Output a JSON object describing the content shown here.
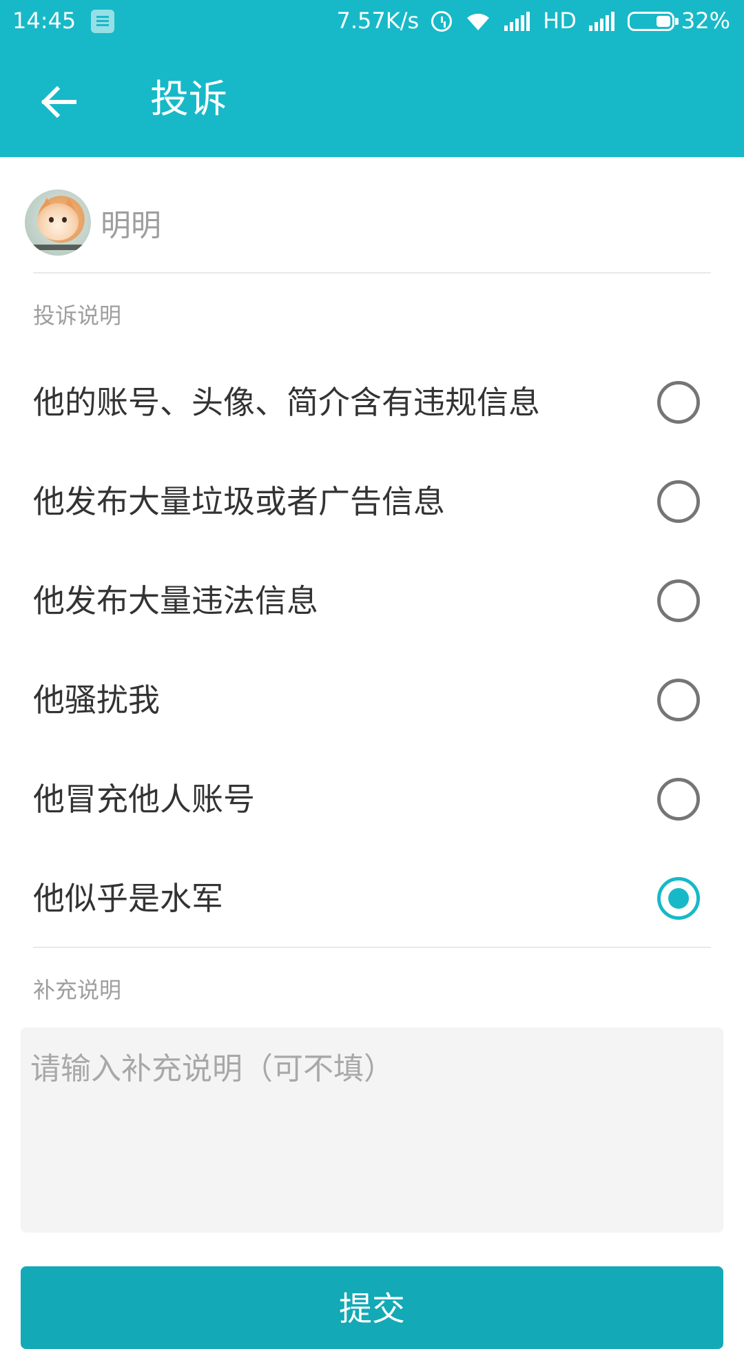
{
  "status_bar": {
    "time": "14:45",
    "net_speed": "7.57K/s",
    "network_type": "HD",
    "battery": "32%",
    "icons": [
      "notification-icon",
      "alarm-icon",
      "wifi-icon",
      "signal-icon",
      "signal-icon",
      "battery-icon"
    ]
  },
  "header": {
    "title": "投诉",
    "back_icon": "arrow-left-icon"
  },
  "user": {
    "name": "明明"
  },
  "complaint": {
    "section_label": "投诉说明",
    "options": [
      {
        "label": "他的账号、头像、简介含有违规信息",
        "checked": false
      },
      {
        "label": "他发布大量垃圾或者广告信息",
        "checked": false
      },
      {
        "label": "他发布大量违法信息",
        "checked": false
      },
      {
        "label": "他骚扰我",
        "checked": false
      },
      {
        "label": "他冒充他人账号",
        "checked": false
      },
      {
        "label": "他似乎是水军",
        "checked": true
      }
    ]
  },
  "supplement": {
    "section_label": "补充说明",
    "placeholder": "请输入补充说明（可不填）",
    "value": ""
  },
  "submit": {
    "label": "提交"
  },
  "colors": {
    "primary": "#17b9c8",
    "button": "#13a9b6",
    "text_primary": "#333333",
    "text_secondary": "#9e9e9e",
    "radio_unchecked": "#757575",
    "input_bg": "#f4f4f4"
  }
}
